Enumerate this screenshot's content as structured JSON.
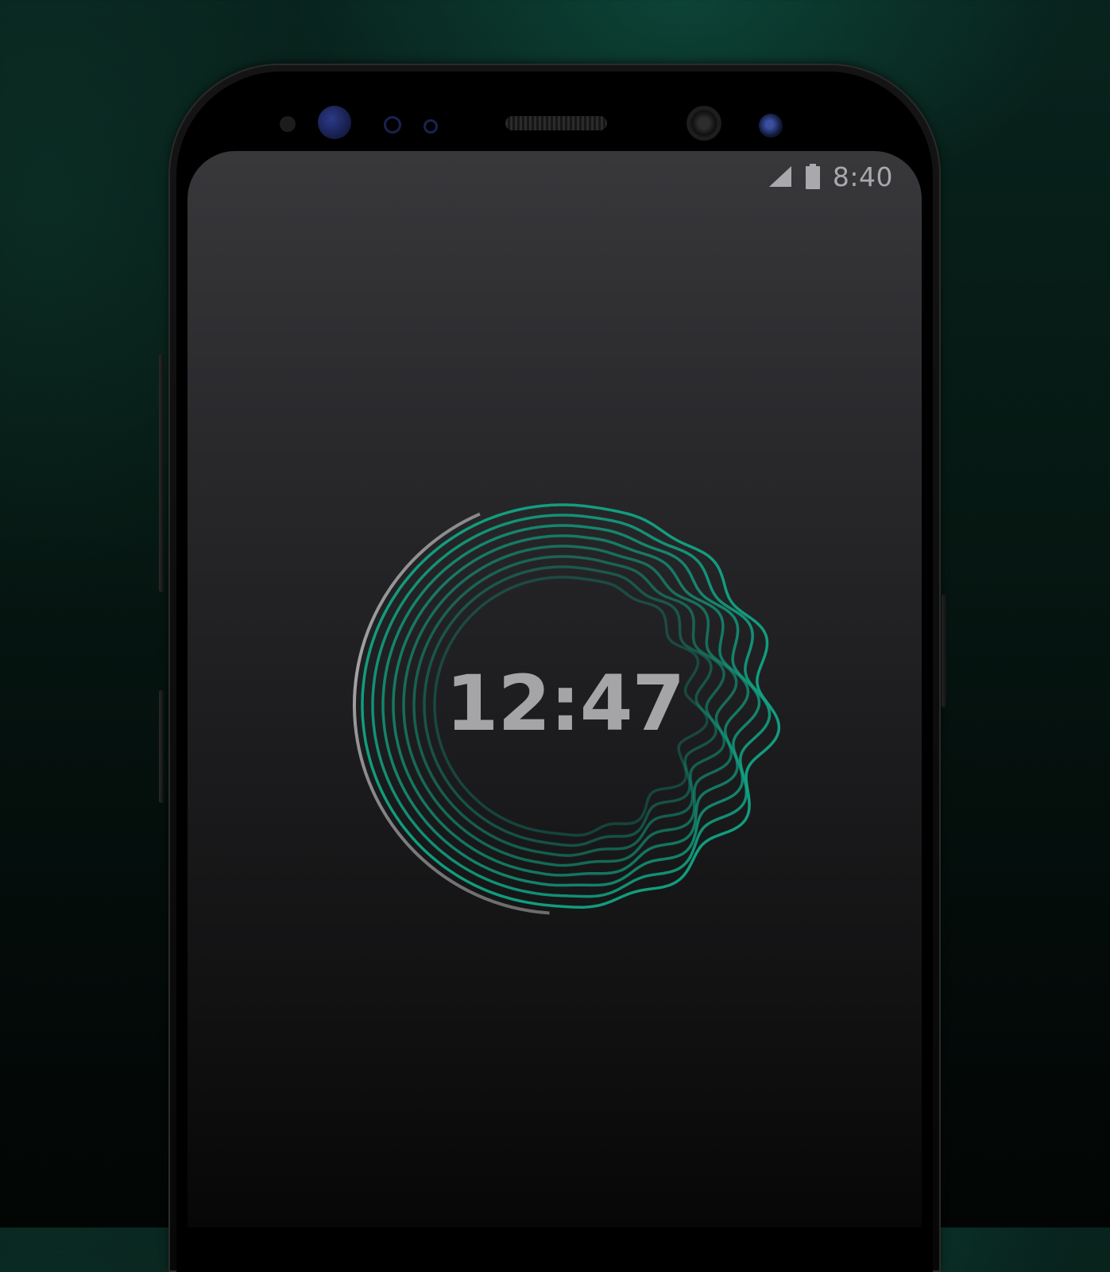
{
  "status_bar": {
    "time": "8:40",
    "signal_icon": "signal-icon",
    "battery_icon": "battery-icon"
  },
  "clock": {
    "time": "12:47"
  },
  "colors": {
    "accent": "#12a383",
    "accent_dark": "#0e6f5a",
    "ring_gray": "#9a9a9c",
    "clock_text": "#a5a5a7",
    "status_text": "#a9a9ad"
  }
}
